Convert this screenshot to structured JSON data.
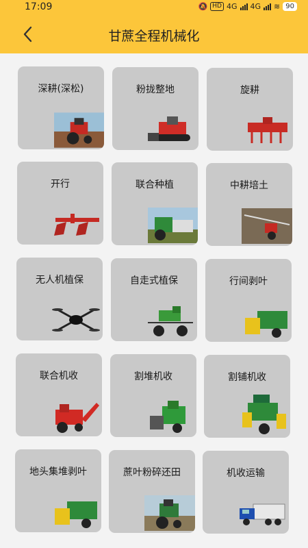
{
  "status_bar": {
    "time": "17:09",
    "hd": "HD",
    "net1": "4G",
    "net2": "4G",
    "battery": "90"
  },
  "header": {
    "title": "甘蔗全程机械化",
    "bg_color": "#fcc63a",
    "back_icon": "back-arrow-icon"
  },
  "cards": [
    {
      "label": "深耕(深松)",
      "icon": "red-tractor-subsoiler-photo"
    },
    {
      "label": "粉拢整地",
      "icon": "red-crawler-rotary-tiller-photo"
    },
    {
      "label": "旋耕",
      "icon": "red-rotary-tiller-photo"
    },
    {
      "label": "开行",
      "icon": "red-ridger-plough-photo"
    },
    {
      "label": "联合种植",
      "icon": "green-tractor-planter-field-photo"
    },
    {
      "label": "中耕培土",
      "icon": "red-cultivator-field-photo"
    },
    {
      "label": "无人机植保",
      "icon": "black-spray-drone-photo"
    },
    {
      "label": "自走式植保",
      "icon": "green-self-propelled-sprayer-photo"
    },
    {
      "label": "行间剥叶",
      "icon": "green-interrow-leaf-stripper-photo"
    },
    {
      "label": "联合机收",
      "icon": "red-combine-harvester-photo"
    },
    {
      "label": "割堆机收",
      "icon": "green-pile-harvester-photo"
    },
    {
      "label": "割铺机收",
      "icon": "green-windrow-harvester-photo"
    },
    {
      "label": "地头集堆剥叶",
      "icon": "green-field-pile-stripper-photo"
    },
    {
      "label": "蔗叶粉碎还田",
      "icon": "green-tractor-leaf-shredder-photo"
    },
    {
      "label": "机收运输",
      "icon": "blue-transport-truck-photo"
    }
  ]
}
